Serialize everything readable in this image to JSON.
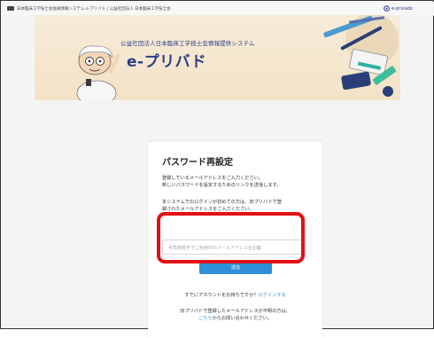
{
  "browser_bar": {
    "breadcrumb": "日本臨床工学技士会会員情報システム e-プリバド | 公益社団法人 日本臨床工学技士会",
    "brand": "e-privado"
  },
  "banner": {
    "subtitle": "公益社団法人日本臨床工学技士会情報提供システム",
    "title": "e-プリバド"
  },
  "card": {
    "heading": "パスワード再設定",
    "intro_line1": "登録しているメールアドレスをご入力ください。",
    "intro_line2": "新しいパスワードを設定するためのリンクを送信します。",
    "note_line1": "本システムでのログインが初めての方は、旧プリバドで登",
    "note_line2": "録されたメールアドレスをご入力ください。",
    "email_placeholder": "半角英数字でご利用中のメールアドレスを記載",
    "send_label": "送信",
    "have_account_text": "すでにアカウントをお持ちですか？",
    "login_link": "ログインする",
    "unknown_text": "旧プリバドで登録したメールアドレスが不明の方は、",
    "contact_link": "こちら",
    "contact_suffix": "からお問い合わせください。"
  },
  "colors": {
    "accent": "#2f8fd8",
    "brand": "#2c3c88",
    "highlight": "#e30f16"
  }
}
